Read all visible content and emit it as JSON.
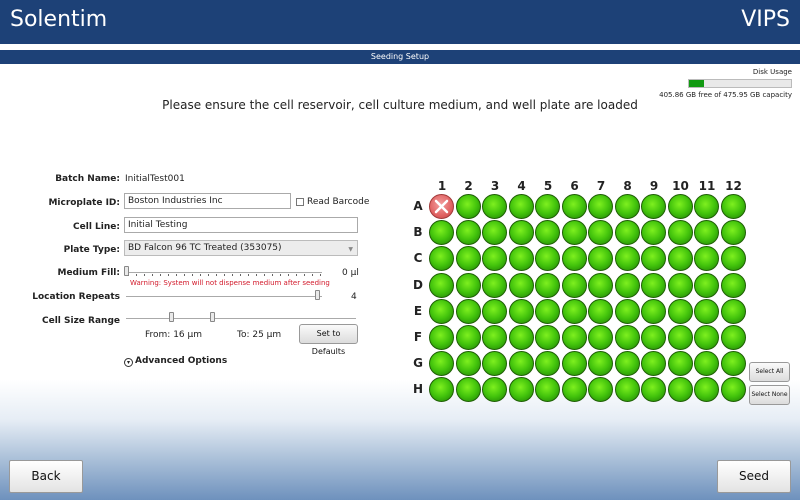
{
  "header": {
    "app_name": "Solentim",
    "product": "VIPS"
  },
  "subheader": {
    "title": "Seeding Setup"
  },
  "disk": {
    "label": "Disk Usage",
    "info": "405.86 GB free of 475.95 GB capacity",
    "used_fraction": 0.147
  },
  "instruction": "Please ensure the cell reservoir, cell culture medium, and well plate are loaded",
  "form": {
    "batch_name_label": "Batch Name:",
    "batch_name_value": "InitialTest001",
    "microplate_label": "Microplate ID:",
    "microplate_value": "Boston Industries Inc",
    "read_barcode_label": "Read Barcode",
    "cell_line_label": "Cell Line:",
    "cell_line_value": "Initial Testing",
    "plate_type_label": "Plate Type:",
    "plate_type_value": "BD Falcon 96 TC Treated (353075)",
    "medium_fill_label": "Medium Fill:",
    "medium_fill_value": "0 µl",
    "medium_warning": "Warning: System will not dispense medium after seeding",
    "location_repeats_label": "Location Repeats",
    "location_repeats_value": "4",
    "cell_size_label": "Cell Size Range",
    "from_label": "From: 16  µm",
    "to_label": "To: 25  µm",
    "set_defaults_label": "Set to Defaults",
    "advanced_label": "Advanced Options"
  },
  "plate": {
    "columns": [
      "1",
      "2",
      "3",
      "4",
      "5",
      "6",
      "7",
      "8",
      "9",
      "10",
      "11",
      "12"
    ],
    "rows": [
      "A",
      "B",
      "C",
      "D",
      "E",
      "F",
      "G",
      "H"
    ],
    "excluded_wells": [
      "A1"
    ],
    "colors": {
      "selected": "#43c40c",
      "excluded": "#e06262"
    }
  },
  "plate_buttons": {
    "select_all": "Select All",
    "select_none": "Select None"
  },
  "footer": {
    "back_label": "Back",
    "seed_label": "Seed"
  }
}
